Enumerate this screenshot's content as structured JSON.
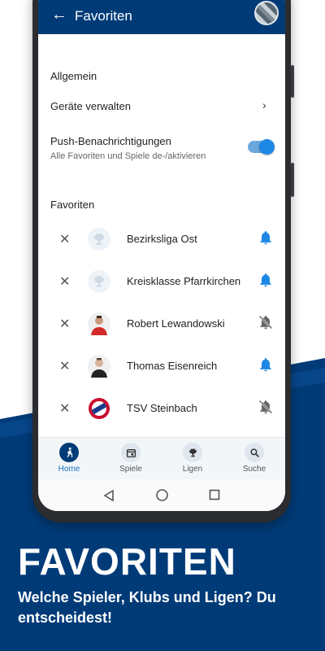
{
  "appbar": {
    "back_icon": "arrow-left-icon",
    "title": "Favoriten"
  },
  "general": {
    "section_title": "Allgemein",
    "devices_label": "Geräte verwalten",
    "push_label": "Push-Benachrichtigungen",
    "push_sub": "Alle Favoriten und Spiele de-/aktivieren",
    "push_enabled": true
  },
  "favorites": {
    "section_title": "Favoriten",
    "items": [
      {
        "name": "Bezirksliga Ost",
        "icon": "trophy-icon",
        "notifications": true
      },
      {
        "name": "Kreisklasse Pfarrkirchen",
        "icon": "trophy-icon",
        "notifications": true
      },
      {
        "name": "Robert Lewandowski",
        "icon": "player-avatar-icon",
        "notifications": false
      },
      {
        "name": "Thomas Eisenreich",
        "icon": "player-avatar-icon",
        "notifications": true
      },
      {
        "name": "TSV Steinbach",
        "icon": "club-crest-icon",
        "notifications": false
      }
    ]
  },
  "bottom_nav": {
    "items": [
      {
        "label": "Home",
        "icon": "home-player-icon",
        "active": true
      },
      {
        "label": "Spiele",
        "icon": "calendar-icon",
        "active": false
      },
      {
        "label": "Ligen",
        "icon": "trophy-icon",
        "active": false
      },
      {
        "label": "Suche",
        "icon": "search-icon",
        "active": false
      }
    ]
  },
  "promo": {
    "headline": "FAVORITEN",
    "subline": "Welche Spieler, Klubs und Ligen? Du entscheidest!"
  },
  "colors": {
    "brand_blue": "#003b78",
    "accent_blue": "#1e88e5",
    "muted_gray": "#666666"
  }
}
